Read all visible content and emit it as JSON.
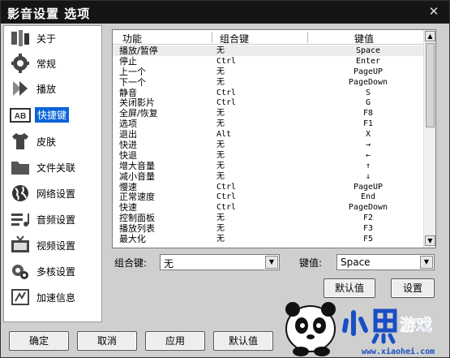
{
  "window": {
    "title": "影音设置 选项",
    "close_glyph": "✕"
  },
  "sidebar": {
    "items": [
      {
        "label": "关于",
        "icon": "tools-icon"
      },
      {
        "label": "常规",
        "icon": "gear-icon"
      },
      {
        "label": "播放",
        "icon": "play-icon"
      },
      {
        "label": "快捷键",
        "icon": "keyboard-ab-icon",
        "selected": true
      },
      {
        "label": "皮肤",
        "icon": "shirt-icon"
      },
      {
        "label": "文件关联",
        "icon": "folder-icon"
      },
      {
        "label": "网络设置",
        "icon": "globe-icon"
      },
      {
        "label": "音频设置",
        "icon": "audio-icon"
      },
      {
        "label": "视频设置",
        "icon": "tv-icon"
      },
      {
        "label": "多核设置",
        "icon": "multicore-icon"
      },
      {
        "label": "加速信息",
        "icon": "accelerate-icon"
      }
    ]
  },
  "table": {
    "headers": {
      "function": "功能",
      "combo": "组合键",
      "key": "键值"
    },
    "rows": [
      {
        "function": "播放/暂停",
        "combo": "无",
        "key": "Space"
      },
      {
        "function": "停止",
        "combo": "Ctrl",
        "key": "Enter"
      },
      {
        "function": "上一个",
        "combo": "无",
        "key": "PageUP"
      },
      {
        "function": "下一个",
        "combo": "无",
        "key": "PageDown"
      },
      {
        "function": "静音",
        "combo": "Ctrl",
        "key": "S"
      },
      {
        "function": "关闭影片",
        "combo": "Ctrl",
        "key": "G"
      },
      {
        "function": "全屏/恢复",
        "combo": "无",
        "key": "F8"
      },
      {
        "function": "选项",
        "combo": "无",
        "key": "F1"
      },
      {
        "function": "退出",
        "combo": "Alt",
        "key": "X"
      },
      {
        "function": "快进",
        "combo": "无",
        "key": "→"
      },
      {
        "function": "快退",
        "combo": "无",
        "key": "←"
      },
      {
        "function": "增大音量",
        "combo": "无",
        "key": "↑"
      },
      {
        "function": "减小音量",
        "combo": "无",
        "key": "↓"
      },
      {
        "function": "慢速",
        "combo": "Ctrl",
        "key": "PageUP"
      },
      {
        "function": "正常速度",
        "combo": "Ctrl",
        "key": "End"
      },
      {
        "function": "快速",
        "combo": "Ctrl",
        "key": "PageDown"
      },
      {
        "function": "控制面板",
        "combo": "无",
        "key": "F2"
      },
      {
        "function": "播放列表",
        "combo": "无",
        "key": "F3"
      },
      {
        "function": "最大化",
        "combo": "无",
        "key": "F5"
      }
    ]
  },
  "fields": {
    "combo_label": "组合键:",
    "combo_value": "无",
    "key_label": "键值:",
    "key_value": "Space"
  },
  "buttons": {
    "default": "默认值",
    "set": "设置",
    "ok": "确定",
    "cancel": "取消",
    "apply": "应用",
    "footer_default": "默认值"
  },
  "watermark": {
    "brand": "小黑游戏",
    "url": "www.xiaohei.com"
  },
  "colors": {
    "selection": "#0a64d8",
    "titlebar": "#151515"
  }
}
